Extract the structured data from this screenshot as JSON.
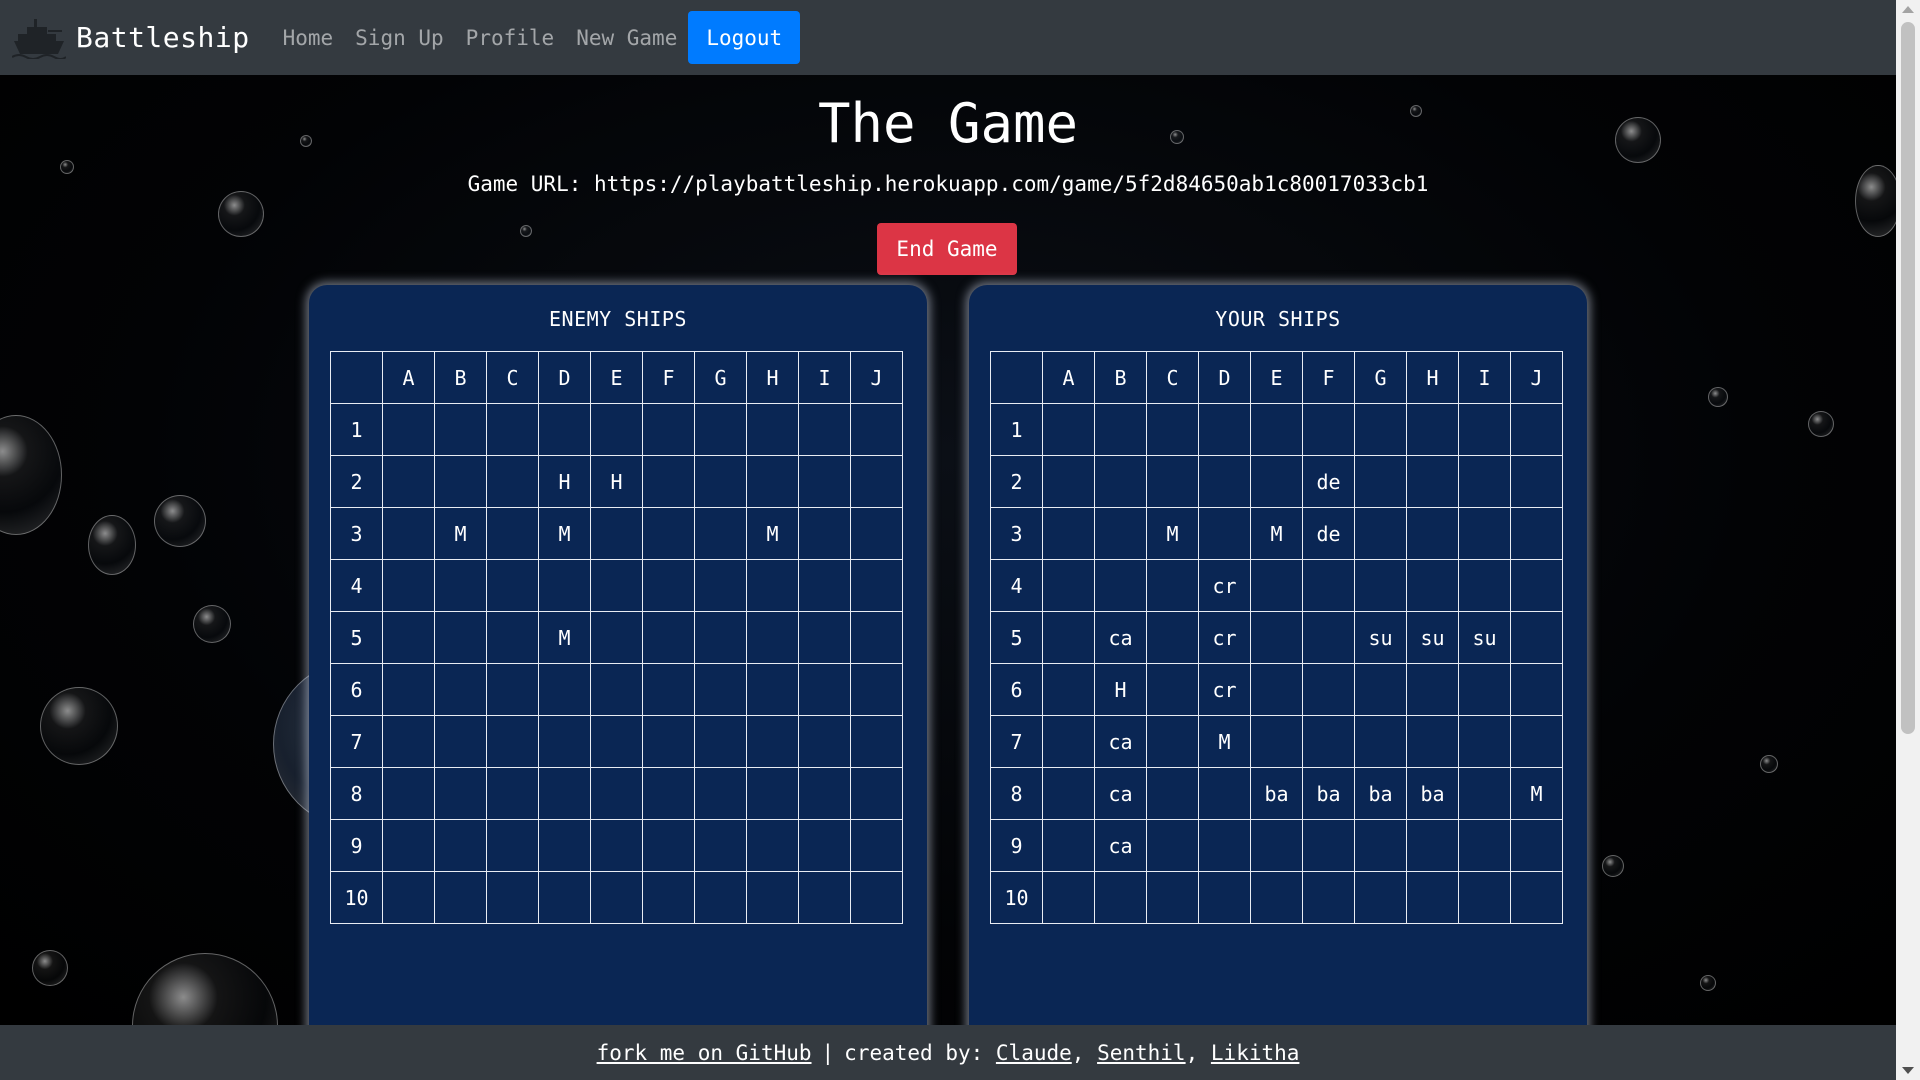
{
  "navbar": {
    "brand": "Battleship",
    "links": [
      "Home",
      "Sign Up",
      "Profile",
      "New Game"
    ],
    "logout_label": "Logout",
    "bg_color": "#343a40",
    "logout_color": "#007bff"
  },
  "main": {
    "title": "The Game",
    "game_url_text": "Game URL: https://playbattleship.herokuapp.com/game/5f2d84650ab1c80017033cb1",
    "end_game_label": "End Game",
    "end_game_color": "#dc3545"
  },
  "boards": {
    "columns": [
      "A",
      "B",
      "C",
      "D",
      "E",
      "F",
      "G",
      "H",
      "I",
      "J"
    ],
    "rows": [
      "1",
      "2",
      "3",
      "4",
      "5",
      "6",
      "7",
      "8",
      "9",
      "10"
    ],
    "enemy": {
      "title": "ENEMY SHIPS",
      "cells": [
        [
          "",
          "",
          "",
          "",
          "",
          "",
          "",
          "",
          "",
          ""
        ],
        [
          "",
          "",
          "",
          "H",
          "H",
          "",
          "",
          "",
          "",
          ""
        ],
        [
          "",
          "M",
          "",
          "M",
          "",
          "",
          "",
          "M",
          "",
          ""
        ],
        [
          "",
          "",
          "",
          "",
          "",
          "",
          "",
          "",
          "",
          ""
        ],
        [
          "",
          "",
          "",
          "M",
          "",
          "",
          "",
          "",
          "",
          ""
        ],
        [
          "",
          "",
          "",
          "",
          "",
          "",
          "",
          "",
          "",
          ""
        ],
        [
          "",
          "",
          "",
          "",
          "",
          "",
          "",
          "",
          "",
          ""
        ],
        [
          "",
          "",
          "",
          "",
          "",
          "",
          "",
          "",
          "",
          ""
        ],
        [
          "",
          "",
          "",
          "",
          "",
          "",
          "",
          "",
          "",
          ""
        ],
        [
          "",
          "",
          "",
          "",
          "",
          "",
          "",
          "",
          "",
          ""
        ]
      ]
    },
    "yours": {
      "title": "YOUR SHIPS",
      "cells": [
        [
          "",
          "",
          "",
          "",
          "",
          "",
          "",
          "",
          "",
          ""
        ],
        [
          "",
          "",
          "",
          "",
          "",
          "de",
          "",
          "",
          "",
          ""
        ],
        [
          "",
          "",
          "M",
          "",
          "M",
          "de",
          "",
          "",
          "",
          ""
        ],
        [
          "",
          "",
          "",
          "cr",
          "",
          "",
          "",
          "",
          "",
          ""
        ],
        [
          "",
          "ca",
          "",
          "cr",
          "",
          "",
          "su",
          "su",
          "su",
          ""
        ],
        [
          "",
          "H",
          "",
          "cr",
          "",
          "",
          "",
          "",
          "",
          ""
        ],
        [
          "",
          "ca",
          "",
          "M",
          "",
          "",
          "",
          "",
          "",
          ""
        ],
        [
          "",
          "ca",
          "",
          "",
          "ba",
          "ba",
          "ba",
          "ba",
          "",
          "M"
        ],
        [
          "",
          "ca",
          "",
          "",
          "",
          "",
          "",
          "",
          "",
          ""
        ],
        [
          "",
          "",
          "",
          "",
          "",
          "",
          "",
          "",
          "",
          ""
        ]
      ]
    },
    "panel_color": "#0a2654"
  },
  "footer": {
    "fork_link": "fork me on GitHub",
    "separator": "|",
    "created_by": "created by:",
    "authors": [
      "Claude",
      "Senthil",
      "Likitha"
    ],
    "comma": ","
  }
}
